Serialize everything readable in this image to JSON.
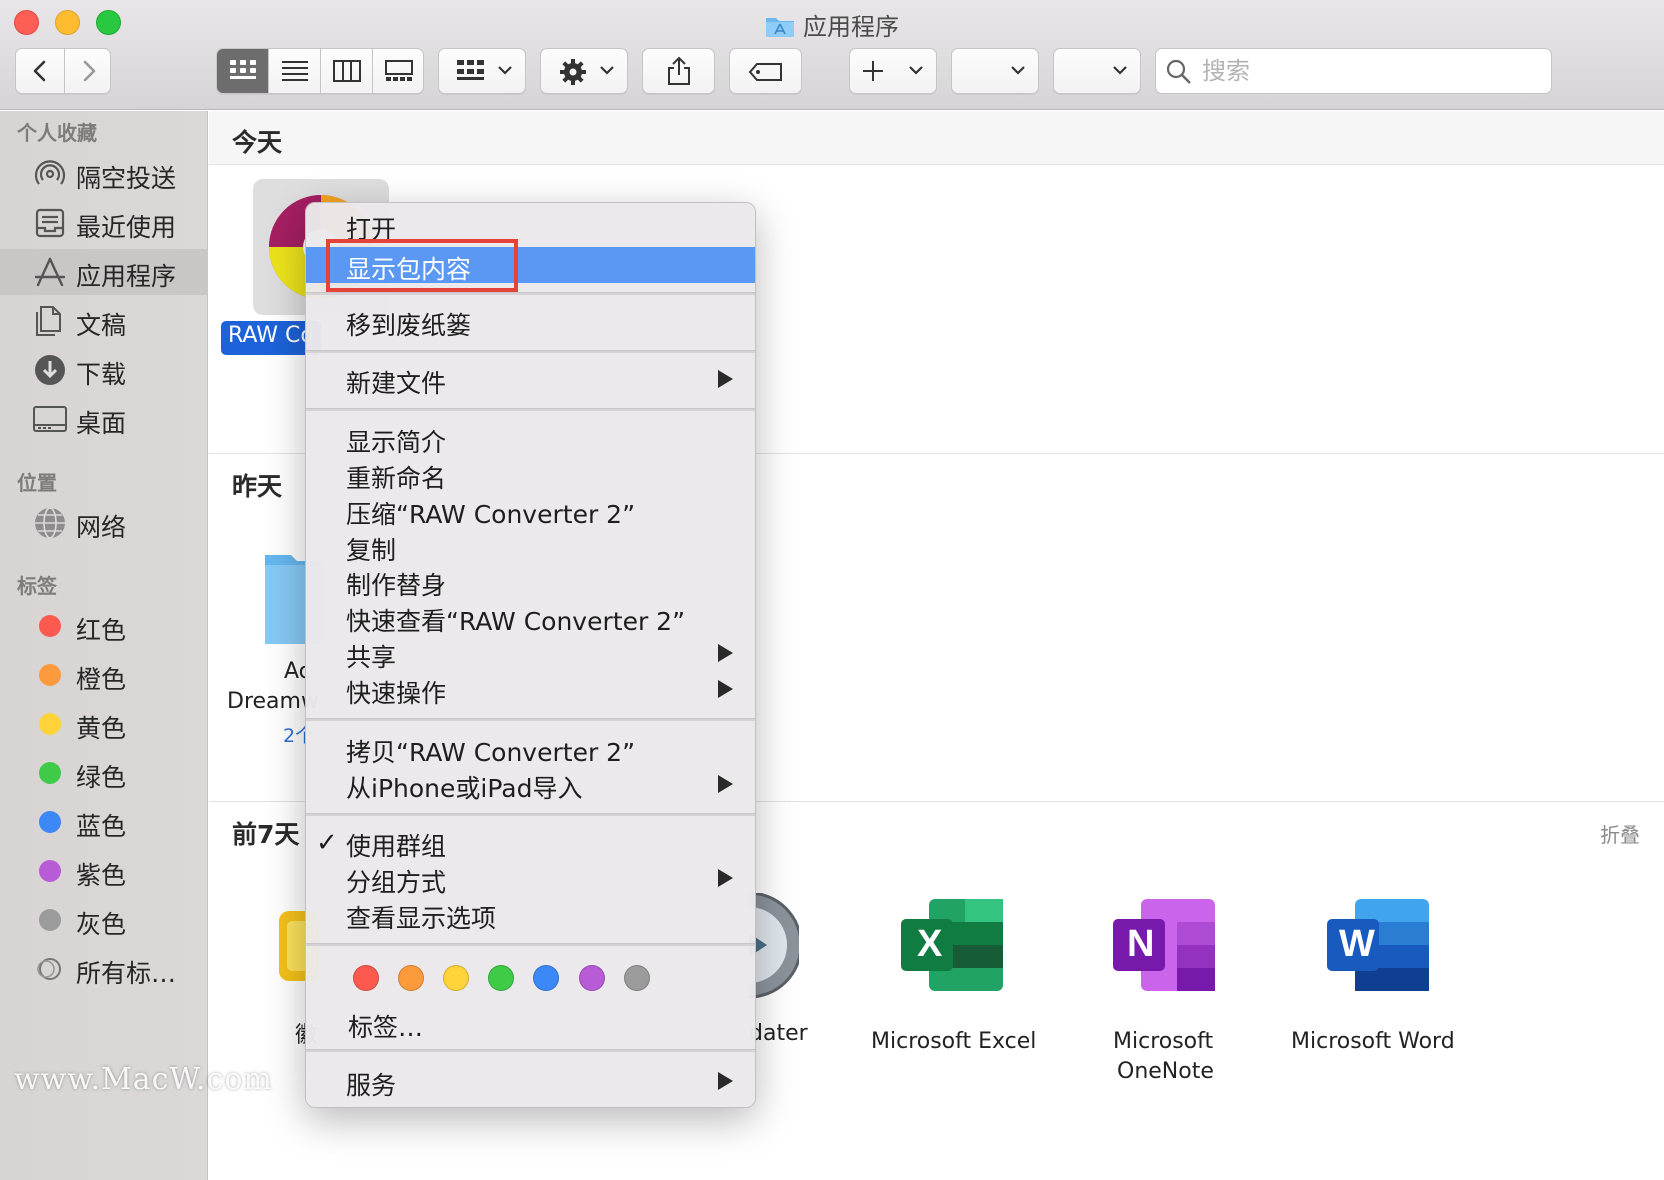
{
  "window": {
    "title": "应用程序"
  },
  "toolbar": {
    "search_placeholder": "搜索"
  },
  "sidebar": {
    "favorites_heading": "个人收藏",
    "favorites": [
      {
        "label": "隔空投送",
        "icon": "airdrop-icon"
      },
      {
        "label": "最近使用",
        "icon": "recents-icon"
      },
      {
        "label": "应用程序",
        "icon": "applications-icon",
        "selected": true
      },
      {
        "label": "文稿",
        "icon": "documents-icon"
      },
      {
        "label": "下载",
        "icon": "downloads-icon"
      },
      {
        "label": "桌面",
        "icon": "desktop-icon"
      }
    ],
    "locations_heading": "位置",
    "locations": [
      {
        "label": "网络",
        "icon": "network-icon"
      }
    ],
    "tags_heading": "标签",
    "tags": [
      {
        "label": "红色",
        "color": "#fd5a4f"
      },
      {
        "label": "橙色",
        "color": "#fd9a3b"
      },
      {
        "label": "黄色",
        "color": "#fed43a"
      },
      {
        "label": "绿色",
        "color": "#3fca48"
      },
      {
        "label": "蓝色",
        "color": "#3b88f6"
      },
      {
        "label": "紫色",
        "color": "#b85bd6"
      },
      {
        "label": "灰色",
        "color": "#9b9b9b"
      },
      {
        "label": "所有标…",
        "color": "none"
      }
    ]
  },
  "content": {
    "sections": {
      "today": "今天",
      "yesterday": "昨天",
      "last7": "前7天"
    },
    "collapse_label": "折叠",
    "today_item": {
      "label_visible": "RAW Co"
    },
    "yesterday_item": {
      "label_line1": "Ac",
      "label_line2": "Dreamw",
      "label_line3": "2个"
    },
    "last7_items": [
      {
        "label": "徽"
      },
      {
        "label": "dater"
      },
      {
        "label": "Microsoft Excel",
        "letter": "X",
        "color": "#1d7044"
      },
      {
        "label_line1": "Microsoft",
        "label_line2": "OneNote",
        "letter": "N",
        "color": "#7b2fb0"
      },
      {
        "label": "Microsoft Word",
        "letter": "W",
        "color": "#1f5cbd"
      }
    ]
  },
  "context_menu": {
    "open": "打开",
    "show_package": "显示包内容",
    "move_trash": "移到废纸篓",
    "new_file": "新建文件",
    "get_info": "显示简介",
    "rename": "重新命名",
    "compress": "压缩“RAW Converter 2”",
    "duplicate": "复制",
    "make_alias": "制作替身",
    "quick_look": "快速查看“RAW Converter 2”",
    "share": "共享",
    "quick_actions": "快速操作",
    "copy": "拷贝“RAW Converter 2”",
    "import_iphone": "从iPhone或iPad导入",
    "use_groups": "使用群组",
    "group_by": "分组方式",
    "view_options": "查看显示选项",
    "tags": "标签…",
    "services": "服务",
    "tag_colors": [
      "#fd5a4f",
      "#fd9a3b",
      "#fed43a",
      "#3fca48",
      "#3b88f6",
      "#b85bd6",
      "#9b9b9b"
    ]
  },
  "watermark": "www.MacW.com"
}
